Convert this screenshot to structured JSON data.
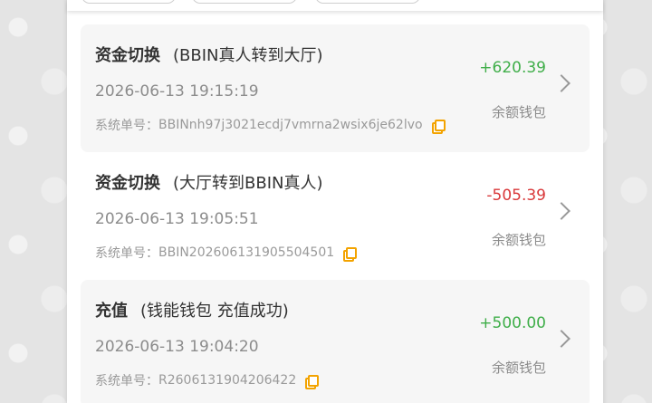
{
  "records": [
    {
      "type": "资金切换",
      "detail": "(BBIN真人转到大厅)",
      "time": "2026-06-13 19:15:19",
      "order_label": "系统单号：",
      "order_no": "BBINnh97j3021ecdj7vmrna2wsix6je62lvo",
      "amount": "+620.39",
      "amount_color": "#3fae49",
      "wallet": "余额钱包"
    },
    {
      "type": "资金切换",
      "detail": "(大厅转到BBIN真人)",
      "time": "2026-06-13 19:05:51",
      "order_label": "系统单号：",
      "order_no": "BBIN202606131905504501",
      "amount": "-505.39",
      "amount_color": "#d9383a",
      "wallet": "余额钱包"
    },
    {
      "type": "充值",
      "detail": "(钱能钱包 充值成功)",
      "time": "2026-06-13 19:04:20",
      "order_label": "系统单号：",
      "order_no": "R2606131904206422",
      "amount": "+500.00",
      "amount_color": "#3fae49",
      "wallet": "余额钱包"
    }
  ]
}
